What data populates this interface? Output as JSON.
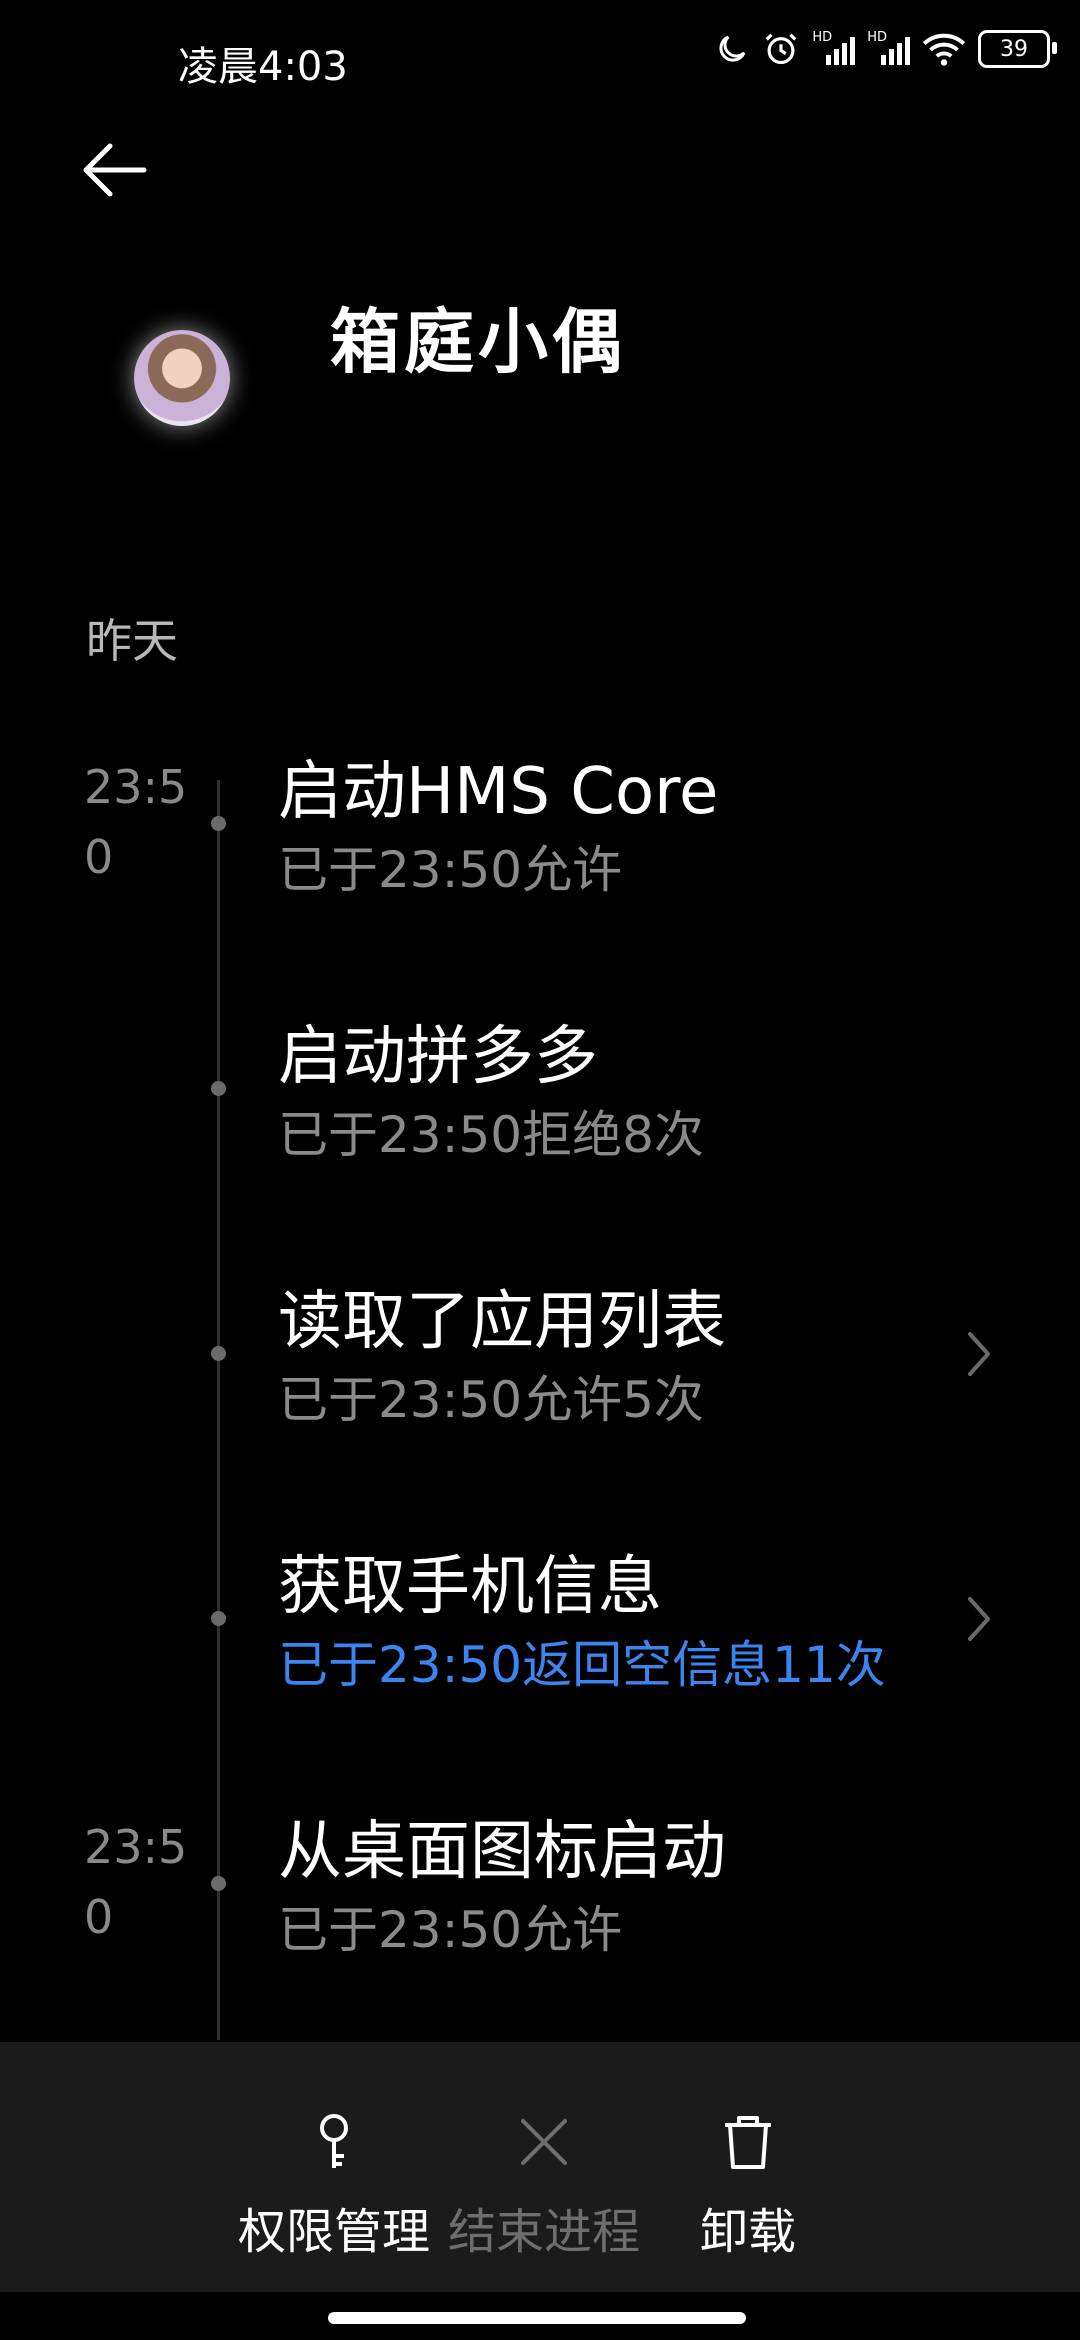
{
  "status_bar": {
    "time": "凌晨4:03",
    "battery": "39",
    "hd1": "HD",
    "hd2": "HD"
  },
  "header": {
    "app_name": "箱庭小偶"
  },
  "section": {
    "date": "昨天"
  },
  "entries": [
    {
      "time": "23:50",
      "title": "启动HMS Core",
      "subtitle": "已于23:50允许",
      "chevron": false
    },
    {
      "time": "",
      "title": "启动拼多多",
      "subtitle": "已于23:50拒绝8次",
      "chevron": false
    },
    {
      "time": "",
      "title": "读取了应用列表",
      "subtitle": "已于23:50允许5次",
      "chevron": true
    },
    {
      "time": "",
      "title": "获取手机信息",
      "subtitle": "已于23:50返回空信息11次",
      "chevron": true,
      "subtitle_color": "#3c84ef"
    },
    {
      "time": "23:50",
      "title": "从桌面图标启动",
      "subtitle": "已于23:50允许",
      "chevron": false
    }
  ],
  "actions": {
    "permissions": "权限管理",
    "end_process": "结束进程",
    "uninstall": "卸载"
  },
  "colors": {
    "accent_blue": "#3c84ef",
    "muted_text": "#8a8a8a",
    "bottom_bar": "#1b1b1b",
    "disabled": "#6e6e6e"
  }
}
